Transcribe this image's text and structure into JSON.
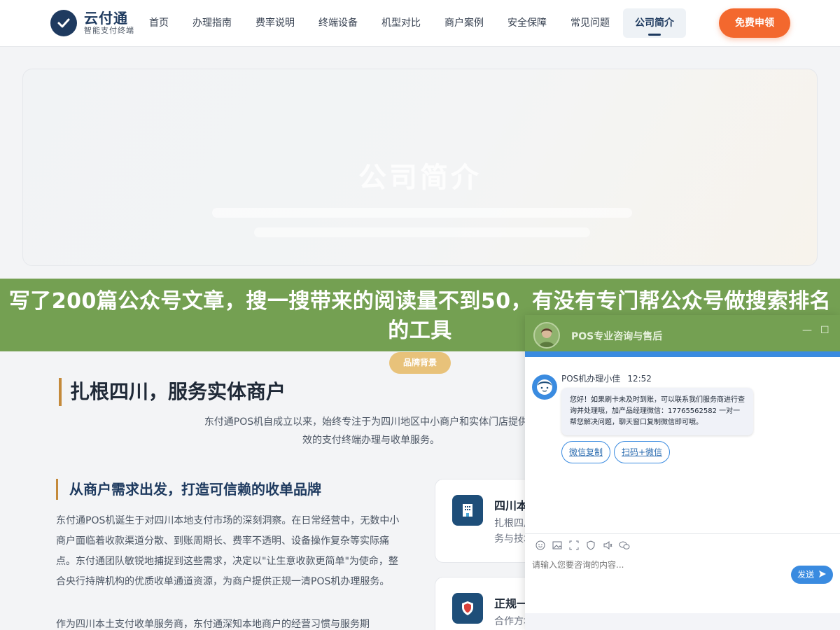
{
  "header": {
    "logo_name": "云付通",
    "logo_sub": "智能支付终端",
    "nav": [
      "首页",
      "办理指南",
      "费率说明",
      "终端设备",
      "机型对比",
      "商户案例",
      "安全保障",
      "常见问题",
      "公司简介"
    ],
    "cta": "免费申领"
  },
  "hero": {
    "title": "公司简介"
  },
  "banner": {
    "text": "写了200篇公众号文章，搜一搜带来的阅读量不到50，有没有专门帮公众号做搜索排名的工具"
  },
  "section": {
    "pill": "品牌背景",
    "title": "扎根四川，服务实体商户",
    "desc": "东付通POS机自成立以来，始终专注于为四川地区中小商户和实体门店提供高效的支付终端办理与收单服务。",
    "subtitle": "从商户需求出发，打造可信赖的收单品牌",
    "para1": "东付通POS机诞生于对四川本地支付市场的深刻洞察。在日常经营中，无数中小商户面临着收款渠道分散、到账周期长、费率不透明、设备操作复杂等实际痛点。东付通团队敏锐地捕捉到这些需求，决定以\"让生意收款更简单\"为使命，整合央行持牌机构的优质收单通道资源，为商户提供正规一清POS机办理服务。",
    "para2": "作为四川本土支付收单服务商，东付通深知本地商户的经营习惯与服务期",
    "cards": [
      {
        "title": "四川本",
        "text": "扎根四川 务与技术"
      },
      {
        "title": "正规一",
        "text": "合作方址"
      }
    ]
  },
  "chat": {
    "title": "POS专业咨询与售后",
    "agent_name": "POS机办理小佳",
    "time": "12:52",
    "message": "您好！如果刷卡未及时到账，可以联系我们服务商进行查询并处理哦，加产品经理微信：17765562582 一对一帮您解决问题，聊天窗口复制微信即可哦。",
    "quick_buttons": [
      "微信复制",
      "扫码+微信"
    ],
    "input_placeholder": "请输入您要咨询的内容...",
    "send_label": "发送",
    "tools": [
      "emoji-icon",
      "image-icon",
      "screenshot-icon",
      "rate-icon",
      "voice-icon",
      "wechat-icon"
    ]
  }
}
